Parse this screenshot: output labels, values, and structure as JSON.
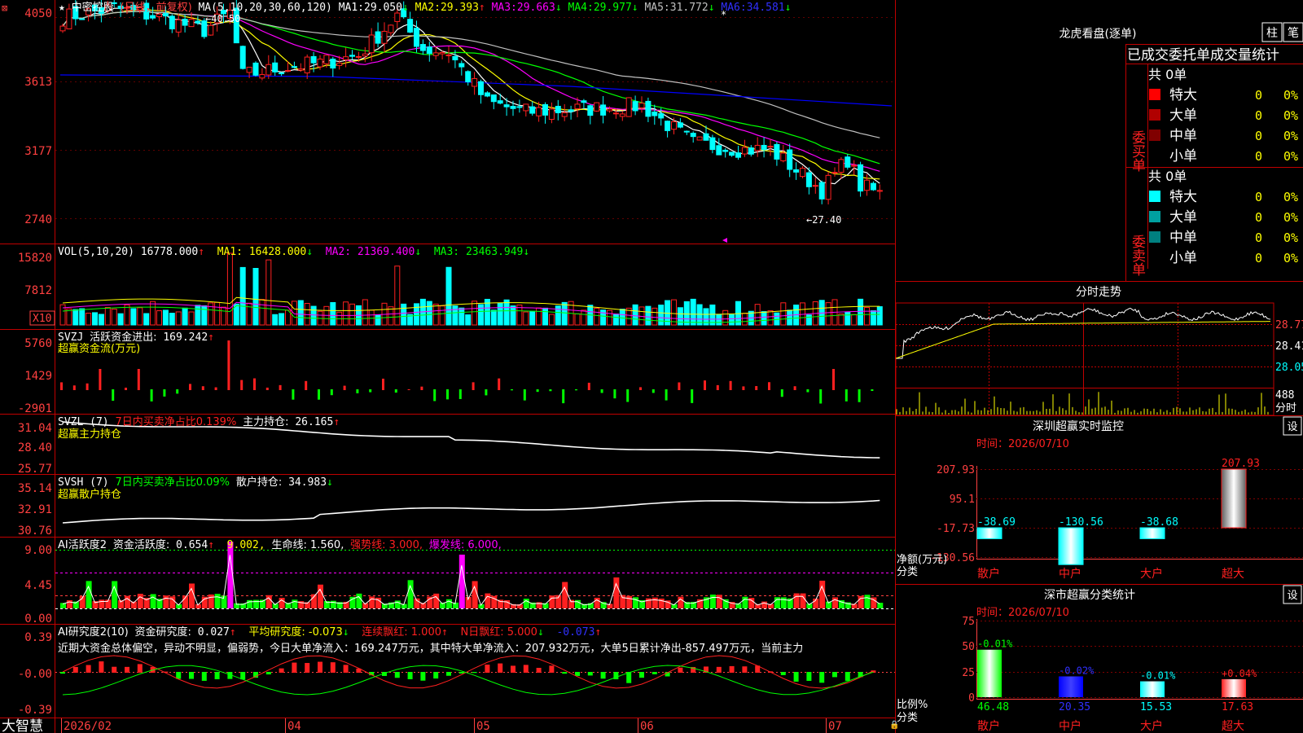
{
  "colors": {
    "up": "#ff2020",
    "down": "#00ffff",
    "grid": "#c00000",
    "axis": "#ff4040",
    "ma1": "#ffffff",
    "ma2": "#ffff00",
    "ma3": "#ff00ff",
    "ma4": "#00ff00",
    "ma5": "#c0c0c0",
    "ma6": "#0000ff"
  },
  "header": {
    "close_icon": "close-icon",
    "star": "★",
    "stock_name": "中密控股",
    "period": "(日线，前复权)",
    "ma_title": "MA(5,10,20,30,60,120)",
    "ma_values": [
      {
        "label": "MA1:",
        "value": "29.050",
        "arrow": "↓"
      },
      {
        "label": "MA2:",
        "value": "29.393",
        "arrow": "↑"
      },
      {
        "label": "MA3:",
        "value": "29.663",
        "arrow": "↓"
      },
      {
        "label": "MA4:",
        "value": "29.977",
        "arrow": "↓"
      },
      {
        "label": "MA5:",
        "value": "31.772",
        "arrow": "↓"
      },
      {
        "label": "MA6:",
        "value": "34.581",
        "arrow": "↓"
      }
    ],
    "high_mark": "40.50",
    "low_mark": "27.40"
  },
  "price_axis": [
    "4050",
    "3613",
    "3177",
    "2740"
  ],
  "vol": {
    "title": "VOL(5,10,20)",
    "value": "16778.000",
    "v_arrow": "↑",
    "ma1": "MA1: 16428.000",
    "ma1_arrow": "↓",
    "ma2": "MA2: 21369.400",
    "ma2_arrow": "↓",
    "ma3": "MA3: 23463.949",
    "ma3_arrow": "↓",
    "axis": [
      "15820",
      "7812"
    ],
    "unit": "X10"
  },
  "svzj": {
    "title": "SVZJ",
    "label": "活跃资金进出:",
    "value": "169.242",
    "arrow": "↑",
    "line2": "超赢资金流(万元)",
    "axis": [
      "5760",
      "1429",
      "-2901"
    ]
  },
  "svzl": {
    "title": "SVZL (7)",
    "line1": "7日内买卖净占比0.139%",
    "label": "主力持仓:",
    "value": "26.165",
    "arrow": "↑",
    "line2": "超赢主力持仓",
    "axis": [
      "31.04",
      "28.40",
      "25.77"
    ]
  },
  "svsh": {
    "title": "SVSH (7)",
    "line1": "7日内买卖净占比0.09%",
    "label": "散户持仓:",
    "value": "34.983",
    "arrow": "↓",
    "line2": "超赢散户持仓",
    "axis": [
      "35.14",
      "32.91",
      "30.76"
    ]
  },
  "ai1": {
    "title": "AI活跃度2",
    "label": "资金活跃度:",
    "value": "0.654",
    "arrow": "↑",
    "v2": "9.002,",
    "life": "生命线: 1.560,",
    "strong": "强势线: 3.000,",
    "burst": "爆发线: 6.000,",
    "axis": [
      "9.00",
      "4.45",
      "0.00"
    ]
  },
  "ai2": {
    "title": "AI研究度2(10)",
    "label": "资金研究度:",
    "value": "0.027",
    "arrow": "↑",
    "avg": "平均研究度: -0.073",
    "avg_arrow": "↓",
    "lian": "连续飘红: 1.000",
    "lian_arrow": "↑",
    "nri": "N日飘红: 5.000",
    "nri_arrow": "↓",
    "last": "-0.073",
    "last_arrow": "↑",
    "axis": [
      "0.39",
      "-0.00",
      "-0.39"
    ],
    "summary": "近期大资金总体偏空，异动不明显，偏弱势，今日大单净流入：169.247万元，其中特大单净流入：207.932万元，大单5日累计净出-857.497万元，当前主力"
  },
  "dates": [
    "2026/02",
    "04",
    "05",
    "06",
    "07"
  ],
  "footer_brand": "大智慧",
  "longhu": {
    "title": "龙虎看盘(逐单)",
    "btn1": "柱",
    "btn2": "笔",
    "heading": "已成交委托单成交量统计",
    "buy": {
      "label": "委买单",
      "total": "共 0单",
      "rows": [
        {
          "name": "特大",
          "v": "0",
          "p": "0%"
        },
        {
          "name": "大单",
          "v": "0",
          "p": "0%"
        },
        {
          "name": "中单",
          "v": "0",
          "p": "0%"
        },
        {
          "name": "小单",
          "v": "0",
          "p": "0%"
        }
      ]
    },
    "sell": {
      "label": "委卖单",
      "total": "共 0单",
      "rows": [
        {
          "name": "特大",
          "v": "0",
          "p": "0%"
        },
        {
          "name": "大单",
          "v": "0",
          "p": "0%"
        },
        {
          "name": "中单",
          "v": "0",
          "p": "0%"
        },
        {
          "name": "小单",
          "v": "0",
          "p": "0%"
        }
      ]
    }
  },
  "fenshi": {
    "title": "分时走势",
    "axis": [
      "28.77",
      "28.41",
      "28.05"
    ],
    "vol_axis": [
      "488",
      "分时"
    ]
  },
  "monitor": {
    "title": "深圳超赢实时监控",
    "btn": "设",
    "time": "时间：2026/07/10",
    "axis": [
      "207.93",
      "95.1",
      "-17.73",
      "-130.56"
    ],
    "unit": "净额(万元)",
    "cat_label": "分类",
    "bars": [
      {
        "cat": "散户",
        "val": "-38.69"
      },
      {
        "cat": "中户",
        "val": "-130.56"
      },
      {
        "cat": "大户",
        "val": "-38.68"
      },
      {
        "cat": "超大",
        "val": "207.93"
      }
    ]
  },
  "stats": {
    "title": "深市超赢分类统计",
    "btn": "设",
    "time": "时间：2026/07/10",
    "axis": [
      "75",
      "50",
      "25",
      "0"
    ],
    "unit": "比例%",
    "cat_label": "分类",
    "bars": [
      {
        "cat": "散户",
        "val": "46.48",
        "chg": "-0.01%"
      },
      {
        "cat": "中户",
        "val": "20.35",
        "chg": "-0.02%"
      },
      {
        "cat": "大户",
        "val": "15.53",
        "chg": "-0.01%"
      },
      {
        "cat": "超大",
        "val": "17.63",
        "chg": "+0.04%"
      }
    ]
  }
}
